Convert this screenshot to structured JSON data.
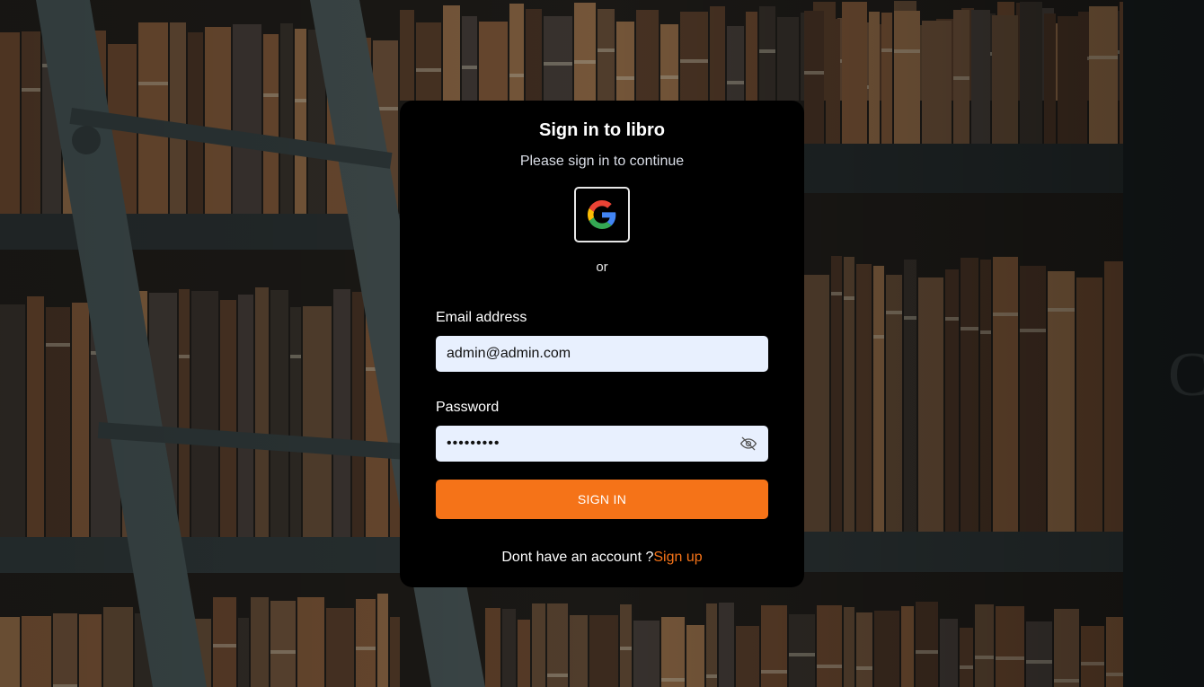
{
  "card": {
    "title": "Sign in to libro",
    "subtitle": "Please sign in to continue",
    "divider_text": "or"
  },
  "google": {
    "icon": "google-logo-icon"
  },
  "form": {
    "email_label": "Email address",
    "email_value": "admin@admin.com",
    "password_label": "Password",
    "password_value": "admin1234",
    "password_toggle_icon": "eye-slash-icon",
    "submit_label": "SIGN IN"
  },
  "footer": {
    "prompt": "Dont have an account ?",
    "signup_label": "Sign up"
  },
  "colors": {
    "accent": "#f57318",
    "card_background": "#000000",
    "input_background": "#e8f0fe"
  }
}
